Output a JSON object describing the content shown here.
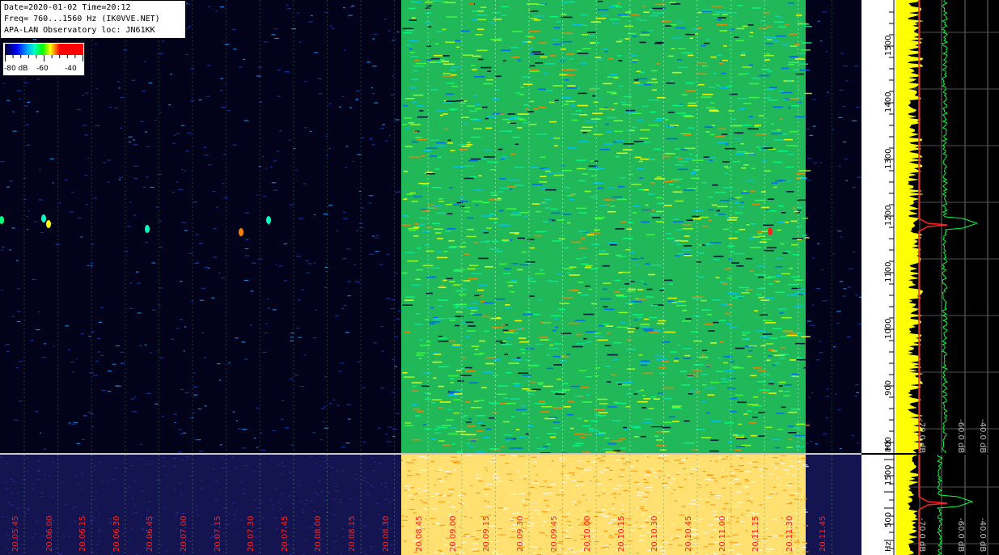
{
  "info": {
    "line1": "Date=2020-01-02 Time=20:12",
    "line2": "Freq= 760...1560 Hz (IK0VVE.NET)",
    "line3": "APA-LAN Observatory loc: JN61KK"
  },
  "scale": {
    "label_80": "-80 dB",
    "label_60": "-60",
    "label_40": "-40"
  },
  "freq_axis": {
    "labels": [
      "1500",
      "1400",
      "1300",
      "1200",
      "1100",
      "1000",
      "900",
      "800"
    ],
    "unit": "Hz"
  },
  "freq_axis_bottom": {
    "labels": [
      "1500",
      "500"
    ],
    "unit": "Hz"
  },
  "spectrum": {
    "db_labels": [
      "-70.0 dB",
      "-60.0 dB",
      "-40.0 dB"
    ]
  },
  "spectrum_bottom": {
    "db_labels": [
      "-70.0 dB",
      "-60.0 dB",
      "-40.0 dB"
    ]
  },
  "time_labels": [
    "20.05.45",
    "20.06.00",
    "20.06.15",
    "20.06.30",
    "20.06.45",
    "20.07.00",
    "20.07.15",
    "20.07.30",
    "20.07.45",
    "20.08.00",
    "20.08.15",
    "20.08.30",
    "20.08.45",
    "20.09.00",
    "20.09.15",
    "20.09.30",
    "20.09.45",
    "20.10.00",
    "20.10.15",
    "20.10.30",
    "20.10.45",
    "20.11.00",
    "20.11.15",
    "20.11.30",
    "20.11.45"
  ],
  "colors": {
    "background": "#02021a",
    "noise_band": "#28c860",
    "time_label": "#ff2020",
    "spectrum_yellow": "#ffff00",
    "spectrum_green": "#00ff40",
    "spectrum_red": "#ff2020"
  }
}
